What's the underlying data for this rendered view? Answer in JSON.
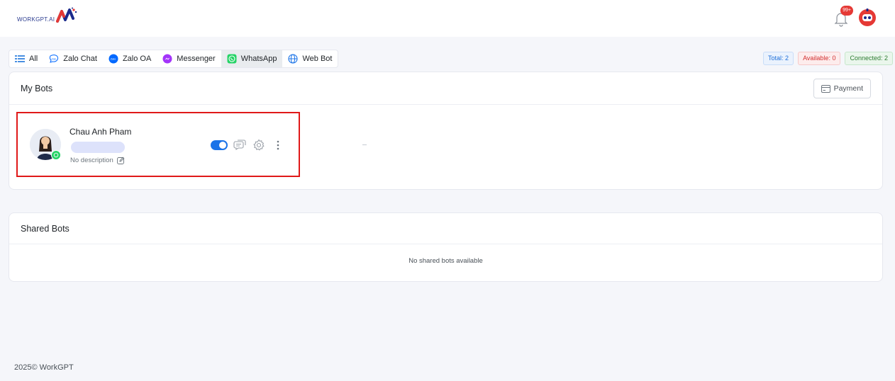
{
  "header": {
    "logo_text": "WORKGPT.AI",
    "notification_count": "99+"
  },
  "tabs": [
    {
      "label": "All",
      "icon": "list-icon",
      "active": false
    },
    {
      "label": "Zalo Chat",
      "icon": "zalo-chat-icon",
      "active": false
    },
    {
      "label": "Zalo OA",
      "icon": "zalo-oa-icon",
      "active": false
    },
    {
      "label": "Messenger",
      "icon": "messenger-icon",
      "active": false
    },
    {
      "label": "WhatsApp",
      "icon": "whatsapp-icon",
      "active": true
    },
    {
      "label": "Web Bot",
      "icon": "globe-icon",
      "active": false
    }
  ],
  "stats": {
    "total": "Total: 2",
    "available": "Available: 0",
    "connected": "Connected: 2"
  },
  "my_bots": {
    "title": "My Bots",
    "payment_label": "Payment",
    "bots": [
      {
        "name": "Chau Anh Pham",
        "description": "No description",
        "enabled": true,
        "platform": "whatsapp"
      }
    ]
  },
  "shared_bots": {
    "title": "Shared Bots",
    "empty_message": "No shared bots available"
  },
  "footer": {
    "text": "2025© WorkGPT"
  },
  "colors": {
    "accent": "#1a73e8",
    "highlight_border": "#e01919",
    "whatsapp": "#25d366",
    "messenger": "#a334fa",
    "zalo": "#0068ff"
  }
}
